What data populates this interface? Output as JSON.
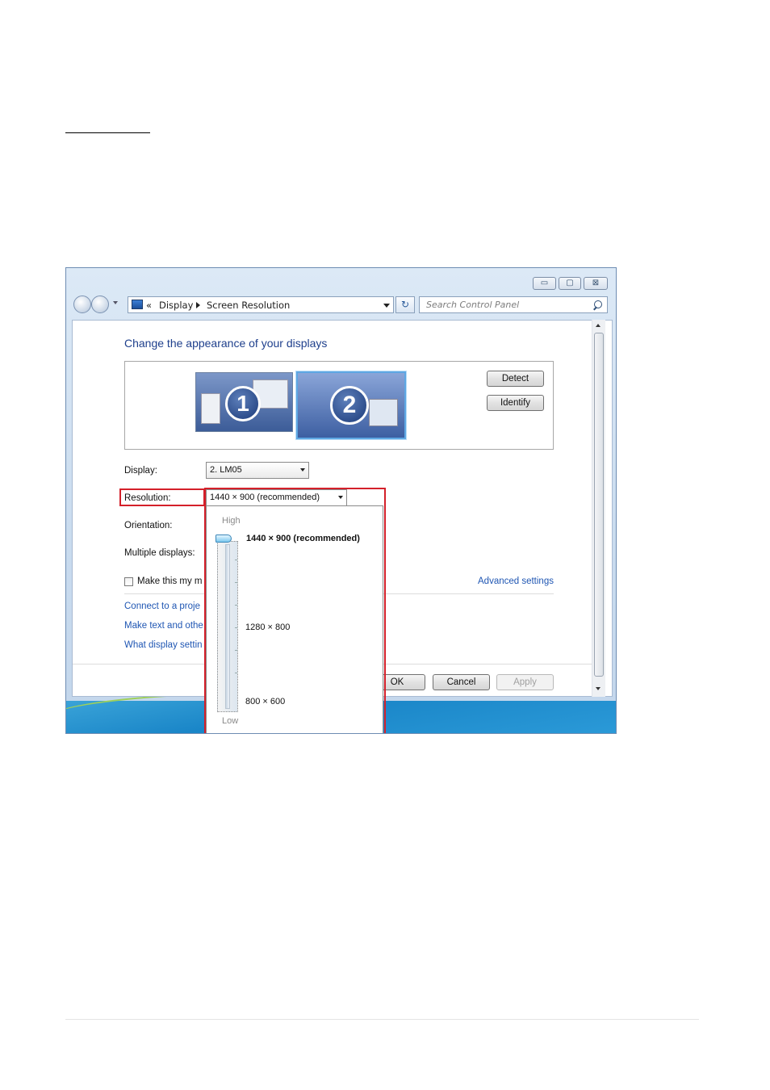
{
  "window": {
    "breadcrumb": {
      "chevrons": "«",
      "item_1": "Display",
      "item_2": "Screen Resolution"
    },
    "search": {
      "placeholder": "Search Control Panel"
    },
    "caption": {
      "minimize": "▭",
      "maximize": "▢",
      "close": "⊠"
    }
  },
  "main": {
    "title": "Change the appearance of your displays",
    "monitors": [
      {
        "number": "1"
      },
      {
        "number": "2"
      }
    ],
    "detect_label": "Detect",
    "identify_label": "Identify",
    "display_label": "Display:",
    "display_value": "2. LM05",
    "resolution_label": "Resolution:",
    "resolution_value": "1440 × 900 (recommended)",
    "orientation_label": "Orientation:",
    "multiple_displays_label": "Multiple displays:",
    "main_display_checkbox_label": "Make this my m",
    "advanced_settings": "Advanced settings",
    "links": [
      "Connect to a proje",
      "Make text and othe",
      "What display settin"
    ],
    "ok_label": "OK",
    "cancel_label": "Cancel",
    "apply_label": "Apply"
  },
  "resolution_dropdown": {
    "high_label": "High",
    "low_label": "Low",
    "options": [
      "1440 × 900 (recommended)",
      "1280 × 800",
      "800 × 600"
    ],
    "selected": "1440 × 900 (recommended)",
    "slider_level": 1.0
  },
  "colors": {
    "highlight": "#d4202a",
    "link": "#1f56b3",
    "title": "#1e3f8c"
  }
}
